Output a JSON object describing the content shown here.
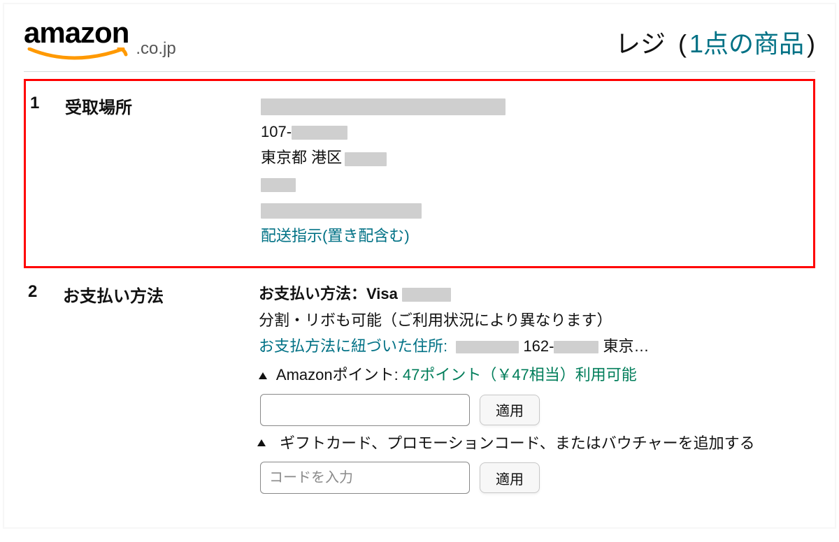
{
  "header": {
    "logo_text": "amazon",
    "logo_suffix": ".co.jp",
    "checkout_label": "レジ",
    "paren_open": "(",
    "cart_summary": "1点の商品",
    "paren_close": ")"
  },
  "section1": {
    "number": "1",
    "title": "受取場所",
    "address": {
      "zip_prefix": "107-",
      "city_part": "東京都 港区",
      "delivery_instructions_link": "配送指示(置き配含む)"
    }
  },
  "section2": {
    "number": "2",
    "title": "お支払い方法",
    "method_label": "お支払い方法：Visa ",
    "install_note": "分割・リボも可能（ご利用状況により異なります）",
    "billing_label": "お支払方法に紐づいた住所:",
    "billing_zip_prefix": " 162-",
    "billing_city_trail": " 東京…",
    "points_prefix": "Amazonポイント: ",
    "points_value": "47ポイント（￥47相当）利用可能",
    "apply1": "適用",
    "accordion_label": "ギフトカード、プロモーションコード、またはバウチャーを追加する",
    "code_placeholder": "コードを入力",
    "apply2": "適用"
  }
}
